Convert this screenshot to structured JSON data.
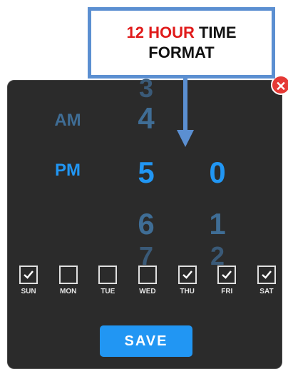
{
  "picker": {
    "ampm": {
      "above": "AM",
      "selected": "PM"
    },
    "hours": {
      "faint_top": "3",
      "above": "4",
      "selected": "5",
      "below": "6",
      "faint_bottom": "7"
    },
    "minutes": {
      "selected": "0",
      "below": "1",
      "faint_bottom": "2"
    }
  },
  "days": [
    {
      "label": "SUN",
      "checked": true
    },
    {
      "label": "MON",
      "checked": false
    },
    {
      "label": "TUE",
      "checked": false
    },
    {
      "label": "WED",
      "checked": false
    },
    {
      "label": "THU",
      "checked": true
    },
    {
      "label": "FRI",
      "checked": true
    },
    {
      "label": "SAT",
      "checked": true
    }
  ],
  "save_label": "SAVE",
  "close_icon": "close-icon",
  "callout": {
    "highlight": "12 HOUR",
    "rest_line1": " TIME",
    "line2": "FORMAT"
  },
  "colors": {
    "accent": "#2196f3",
    "panel": "#2b2b2b",
    "close": "#e53935",
    "callout_border": "#5b8fd1",
    "callout_highlight": "#e01b1b"
  }
}
